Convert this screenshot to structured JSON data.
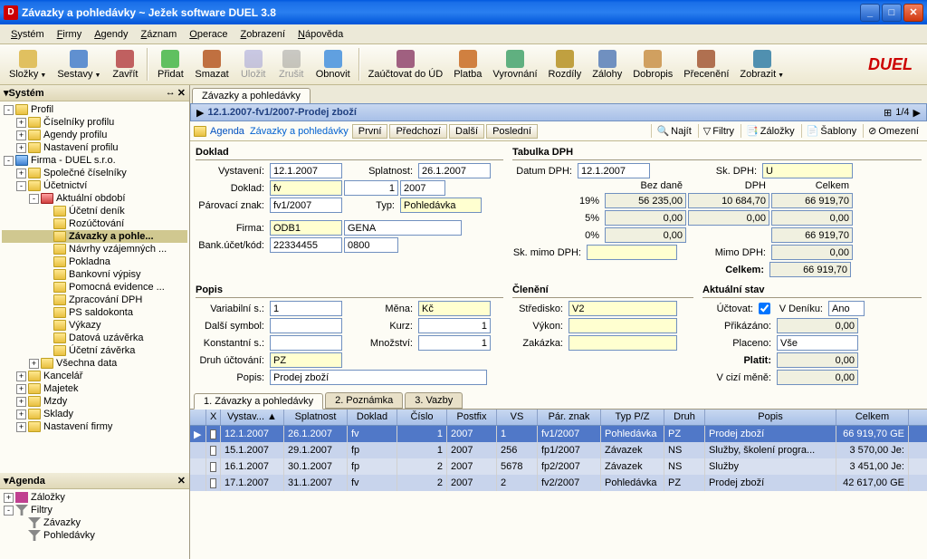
{
  "window": {
    "title": "Závazky a pohledávky ~ Ježek software DUEL 3.8"
  },
  "menu": [
    "Systém",
    "Firmy",
    "Agendy",
    "Záznam",
    "Operace",
    "Zobrazení",
    "Nápověda"
  ],
  "toolbar": [
    {
      "label": "Složky",
      "drop": true
    },
    {
      "label": "Sestavy",
      "drop": true
    },
    {
      "label": "Zavřít"
    },
    "sep",
    {
      "label": "Přidat"
    },
    {
      "label": "Smazat"
    },
    {
      "label": "Uložit",
      "disabled": true
    },
    {
      "label": "Zrušit",
      "disabled": true
    },
    {
      "label": "Obnovit"
    },
    "sep",
    {
      "label": "Zaúčtovat do ÚD"
    },
    {
      "label": "Platba"
    },
    {
      "label": "Vyrovnání"
    },
    {
      "label": "Rozdíly"
    },
    {
      "label": "Zálohy"
    },
    {
      "label": "Dobropis"
    },
    {
      "label": "Přecenění"
    },
    {
      "label": "Zobrazit",
      "drop": true
    }
  ],
  "tree_system_title": "Systém",
  "tree_agenda_title": "Agenda",
  "tree": [
    {
      "l": 0,
      "exp": "-",
      "ico": "folder-y",
      "t": "Profil"
    },
    {
      "l": 1,
      "exp": "+",
      "ico": "folder-y",
      "t": "Číselníky profilu"
    },
    {
      "l": 1,
      "exp": "+",
      "ico": "folder-y",
      "t": "Agendy profilu"
    },
    {
      "l": 1,
      "exp": "+",
      "ico": "folder-y",
      "t": "Nastavení profilu"
    },
    {
      "l": 0,
      "exp": "-",
      "ico": "folder-b",
      "t": "Firma - DUEL s.r.o."
    },
    {
      "l": 1,
      "exp": "+",
      "ico": "folder-y",
      "t": "Společné číselníky"
    },
    {
      "l": 1,
      "exp": "-",
      "ico": "folder-y",
      "t": "Účetnictví"
    },
    {
      "l": 2,
      "exp": "-",
      "ico": "folder-r",
      "t": "Aktuální období"
    },
    {
      "l": 3,
      "ico": "folder-y",
      "t": "Účetní deník"
    },
    {
      "l": 3,
      "ico": "folder-y",
      "t": "Rozúčtování"
    },
    {
      "l": 3,
      "ico": "folder-y",
      "t": "Závazky a pohle...",
      "sel": true
    },
    {
      "l": 3,
      "ico": "folder-y",
      "t": "Návrhy vzájemných ..."
    },
    {
      "l": 3,
      "ico": "folder-y",
      "t": "Pokladna"
    },
    {
      "l": 3,
      "ico": "folder-y",
      "t": "Bankovní výpisy"
    },
    {
      "l": 3,
      "ico": "folder-y",
      "t": "Pomocná evidence ..."
    },
    {
      "l": 3,
      "ico": "folder-y",
      "t": "Zpracování DPH"
    },
    {
      "l": 3,
      "ico": "folder-y",
      "t": "PS saldokonta"
    },
    {
      "l": 3,
      "ico": "folder-y",
      "t": "Výkazy"
    },
    {
      "l": 3,
      "ico": "folder-y",
      "t": "Datová uzávěrka"
    },
    {
      "l": 3,
      "ico": "folder-y",
      "t": "Účetní závěrka"
    },
    {
      "l": 2,
      "exp": "+",
      "ico": "folder-y",
      "t": "Všechna data"
    },
    {
      "l": 1,
      "exp": "+",
      "ico": "folder-y",
      "t": "Kancelář"
    },
    {
      "l": 1,
      "exp": "+",
      "ico": "folder-y",
      "t": "Majetek"
    },
    {
      "l": 1,
      "exp": "+",
      "ico": "folder-y",
      "t": "Mzdy"
    },
    {
      "l": 1,
      "exp": "+",
      "ico": "folder-y",
      "t": "Sklady"
    },
    {
      "l": 1,
      "exp": "+",
      "ico": "folder-y",
      "t": "Nastavení firmy"
    }
  ],
  "agenda_tree": [
    {
      "l": 0,
      "exp": "+",
      "ico": "bookmark",
      "t": "Záložky"
    },
    {
      "l": 0,
      "exp": "-",
      "ico": "filter",
      "t": "Filtry"
    },
    {
      "l": 1,
      "ico": "filter",
      "t": "Závazky"
    },
    {
      "l": 1,
      "ico": "filter",
      "t": "Pohledávky"
    }
  ],
  "tab_title": "Závazky a pohledávky",
  "record_title": "12.1.2007-fv1/2007-Prodej zboží",
  "pager": "1/4",
  "breadcrumb": {
    "agenda": "Agenda",
    "link": "Závazky a pohledávky",
    "first": "První",
    "prev": "Předchozí",
    "next": "Další",
    "last": "Poslední"
  },
  "tools": {
    "najit": "Najít",
    "filtry": "Filtry",
    "zalozky": "Záložky",
    "sablony": "Šablony",
    "omezeni": "Omezení"
  },
  "sections": {
    "doklad": "Doklad",
    "tabulka_dph": "Tabulka DPH",
    "popis": "Popis",
    "cleneni": "Členění",
    "aktualni_stav": "Aktuální stav"
  },
  "doklad": {
    "vystaveni_l": "Vystavení:",
    "vystaveni": "12.1.2007",
    "splatnost_l": "Splatnost:",
    "splatnost": "26.1.2007",
    "doklad_l": "Doklad:",
    "doklad": "fv",
    "doklad_n": "1",
    "doklad_y": "2007",
    "par_l": "Párovací znak:",
    "par": "fv1/2007",
    "typ_l": "Typ:",
    "typ": "Pohledávka",
    "firma_l": "Firma:",
    "firma": "ODB1",
    "firma2": "GENA",
    "bank_l": "Bank.účet/kód:",
    "bank": "22334455",
    "bank2": "0800"
  },
  "dph": {
    "datum_l": "Datum DPH:",
    "datum": "12.1.2007",
    "sk_l": "Sk. DPH:",
    "sk": "U",
    "bez_l": "Bez daně",
    "dph_l": "DPH",
    "celkem_l": "Celkem",
    "r19": "19%",
    "r19_bez": "56 235,00",
    "r19_dph": "10 684,70",
    "r19_cel": "66 919,70",
    "r5": "5%",
    "r5_bez": "0,00",
    "r5_dph": "0,00",
    "r5_cel": "0,00",
    "r0": "0%",
    "r0_bez": "0,00",
    "r0_cel": "66 919,70",
    "skmimo_l": "Sk. mimo DPH:",
    "skmimo": "",
    "mimo_l": "Mimo DPH:",
    "mimo": "0,00",
    "celkem2_l": "Celkem:",
    "celkem2": "66 919,70"
  },
  "popis": {
    "vs_l": "Variabilní s.:",
    "vs": "1",
    "mena_l": "Měna:",
    "mena": "Kč",
    "ds_l": "Další symbol:",
    "ds": "",
    "kurz_l": "Kurz:",
    "kurz": "1",
    "ks_l": "Konstantní s.:",
    "ks": "",
    "mnoz_l": "Množství:",
    "mnoz": "1",
    "druh_l": "Druh účtování:",
    "druh": "PZ",
    "popis_l": "Popis:",
    "popis": "Prodej zboží"
  },
  "cleneni": {
    "stredisko_l": "Středisko:",
    "stredisko": "V2",
    "vykon_l": "Výkon:",
    "vykon": "",
    "zakazka_l": "Zakázka:",
    "zakazka": ""
  },
  "stav": {
    "uctovat_l": "Účtovat:",
    "deniku_l": "V Deníku:",
    "deniku": "Ano",
    "prikazano_l": "Přikázáno:",
    "prikazano": "0,00",
    "placeno_l": "Placeno:",
    "placeno": "Vše",
    "platit_l": "Platit:",
    "platit": "0,00",
    "cizi_l": "V cizí měně:",
    "cizi": "0,00"
  },
  "btabs": [
    "1. Závazky a pohledávky",
    "2. Poznámka",
    "3. Vazby"
  ],
  "grid": {
    "headers": [
      "",
      "X",
      "Vystav...",
      "Splatnost",
      "Doklad",
      "Číslo",
      "Postfix",
      "VS",
      "Pár. znak",
      "Typ P/Z",
      "Druh",
      "Popis",
      "Celkem"
    ],
    "rows": [
      {
        "sel": true,
        "vyst": "12.1.2007",
        "spl": "26.1.2007",
        "dok": "fv",
        "cis": "1",
        "post": "2007",
        "vs": "1",
        "par": "fv1/2007",
        "typ": "Pohledávka",
        "druh": "PZ",
        "popis": "Prodej zboží",
        "cel": "66 919,70 GE"
      },
      {
        "vyst": "15.1.2007",
        "spl": "29.1.2007",
        "dok": "fp",
        "cis": "1",
        "post": "2007",
        "vs": "256",
        "par": "fp1/2007",
        "typ": "Závazek",
        "druh": "NS",
        "popis": "Služby, školení progra...",
        "cel": "3 570,00 Je:"
      },
      {
        "vyst": "16.1.2007",
        "spl": "30.1.2007",
        "dok": "fp",
        "cis": "2",
        "post": "2007",
        "vs": "5678",
        "par": "fp2/2007",
        "typ": "Závazek",
        "druh": "NS",
        "popis": "Služby",
        "cel": "3 451,00 Je:"
      },
      {
        "vyst": "17.1.2007",
        "spl": "31.1.2007",
        "dok": "fv",
        "cis": "2",
        "post": "2007",
        "vs": "2",
        "par": "fv2/2007",
        "typ": "Pohledávka",
        "druh": "PZ",
        "popis": "Prodej zboží",
        "cel": "42 617,00 GE"
      }
    ]
  }
}
